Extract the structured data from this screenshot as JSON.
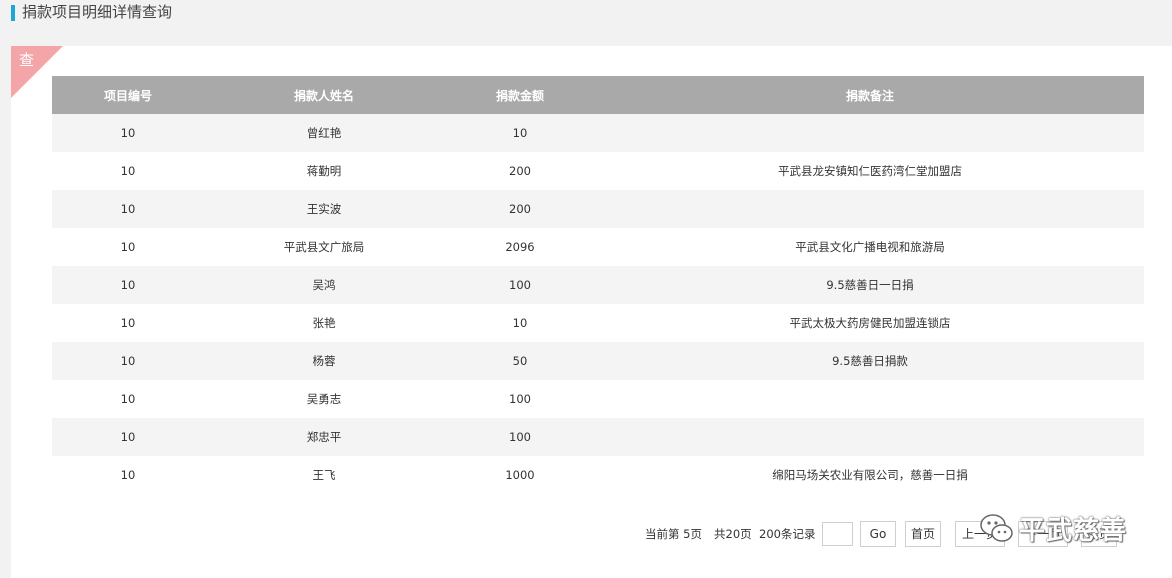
{
  "header": {
    "title": "捐款项目明细详情查询"
  },
  "corner_label": "查",
  "table": {
    "columns": [
      "项目编号",
      "捐款人姓名",
      "捐款金额",
      "捐款备注"
    ],
    "rows": [
      [
        "10",
        "曾红艳",
        "10",
        ""
      ],
      [
        "10",
        "蒋勤明",
        "200",
        "平武县龙安镇知仁医药湾仁堂加盟店"
      ],
      [
        "10",
        "王实波",
        "200",
        ""
      ],
      [
        "10",
        "平武县文广旅局",
        "2096",
        "平武县文化广播电视和旅游局"
      ],
      [
        "10",
        "吴鸿",
        "100",
        "9.5慈善日一日捐"
      ],
      [
        "10",
        "张艳",
        "10",
        "平武太极大药房健民加盟连锁店"
      ],
      [
        "10",
        "杨蓉",
        "50",
        "9.5慈善日捐款"
      ],
      [
        "10",
        "吴勇志",
        "100",
        ""
      ],
      [
        "10",
        "郑忠平",
        "100",
        ""
      ],
      [
        "10",
        "王飞",
        "1000",
        "绵阳马场关农业有限公司，慈善一日捐"
      ]
    ]
  },
  "pager": {
    "current_page": "当前第  5页",
    "total_pages": "共20页",
    "total_records": "200条记录",
    "input_value": "",
    "go_label": "Go",
    "first_label": "首页",
    "prev_label": "上一页",
    "next_label": "下一页",
    "last_label": "尾页"
  },
  "watermark": {
    "text": "平武慈善",
    "icon": "wechat-icon"
  }
}
